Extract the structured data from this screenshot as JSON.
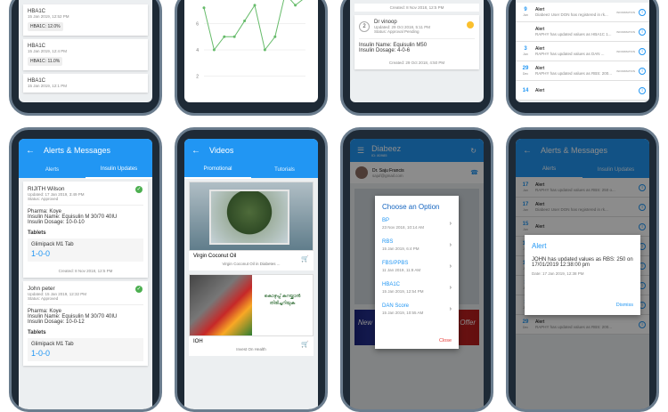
{
  "panel_top1": {
    "cards": [
      {
        "title": "HBA1C",
        "date": "15 Jan 2019, 12:52 PM",
        "value": "HBA1C: 12.0%"
      },
      {
        "title": "HBA1C",
        "date": "15 Jan 2019, 12:4 PM",
        "value": "HBA1C: 11.0%"
      },
      {
        "title": "HBA1C",
        "date": "15 Jan 2019, 12:1 PM"
      }
    ]
  },
  "panel_top2": {
    "chart_data": {
      "type": "line",
      "y_ticks": [
        "8",
        "6",
        "4",
        "2"
      ],
      "ylim": [
        0,
        8
      ],
      "grid": true,
      "values": [
        7.2,
        4,
        5,
        5,
        6.2,
        7.4,
        4,
        5,
        8.4,
        7.4,
        8
      ],
      "color": "#66bb6a"
    }
  },
  "panel_top3": {
    "created_top": "Created: 8 Nov 2018, 12:5 PM",
    "doctor_num": "2",
    "doctor_name": "Dr vinoop",
    "updated": "Updated: 29 Oct 2018, 5:11 PM",
    "status": "Status: Approval Pending",
    "insulin_name": "Insulin Name: Equisulin M50",
    "insulin_dosage": "Insulin Dosage: 4-0-6",
    "created": "Created: 29 Oct 2018, 4:50 PM"
  },
  "panel_top4": {
    "rows": [
      {
        "day": "9",
        "mon": "Jan",
        "title": "Alert",
        "text": "Diabeez User DON has registered in rk...",
        "tag": "INFORMATION"
      },
      {
        "day": "",
        "mon": "",
        "title": "Alert",
        "text": "RAPHY has updated values as HBA1C 1...",
        "tag": "INFORMATION"
      },
      {
        "day": "3",
        "mon": "Jan",
        "title": "Alert",
        "text": "RAPHY has updated values as DAN ...",
        "tag": "INFORMATION"
      },
      {
        "day": "29",
        "mon": "Dec",
        "title": "Alert",
        "text": "RAPHY has updated values as RBS: 200...",
        "tag": "INFORMATION"
      },
      {
        "day": "14",
        "mon": "",
        "title": "Alert",
        "text": "",
        "tag": ""
      }
    ]
  },
  "panel_alerts": {
    "title": "Alerts & Messages",
    "tabs": [
      "Alerts",
      "Insulin Updates"
    ],
    "card1": {
      "name": "RIJITH Wilson",
      "updated": "Updated: 17 Jan 2019, 3:49 PM",
      "status": "Status: Approved",
      "pharma": "Pharma: Koye",
      "insulin_name": "Insulin Name: Equisulin M 30/70 40IU",
      "insulin_dosage": "Insulin Dosage: 10-0-10",
      "tablets_label": "Tablets",
      "tablet_name": "Glimipack M1 Tab",
      "tablet_dose": "1-0-0",
      "created": "Created: 8 Nov 2018, 12:5 PM"
    },
    "card2": {
      "name": "John peter",
      "updated": "Updated: 15 Jan 2019, 12:32 PM",
      "status": "Status: Approved",
      "pharma": "Pharma: Koye",
      "insulin_name": "Insulin Name: Equisulin M 30/70 40IU",
      "insulin_dosage": "Insulin Dosage: 10-0-12",
      "tablets_label": "Tablets",
      "tablet_name": "Glimipack M1 Tab",
      "tablet_dose": "1-0-0"
    }
  },
  "panel_videos": {
    "title": "Videos",
    "tabs": [
      "Promotional",
      "Tutorials"
    ],
    "items": [
      {
        "title": "Virgin Coconut Oil",
        "subtitle": "Virgin Coconut Oil in Diabetes ..."
      },
      {
        "title": "IOH",
        "subtitle": "Invest On Health"
      }
    ],
    "ad_text": "കൊഴുപ്പ് കുറയ്ക്കാൻ തിരിച്ചറിയുക"
  },
  "panel_options": {
    "app_title": "Diabeez",
    "app_subtitle": "ID: 80985",
    "doctor": "Dr. Saju Francis",
    "email": "sajuf@gmail.com",
    "dialog_title": "Choose an Option",
    "options": [
      {
        "label": "BP",
        "date": "23 Nov 2018, 10:14 AM"
      },
      {
        "label": "RBS",
        "date": "15 Jan 2019, 6:4 PM"
      },
      {
        "label": "FBS/PPBS",
        "date": "11 Jan 2019, 11:8 AM"
      },
      {
        "label": "HBA1C",
        "date": "15 Jan 2019, 12:54 PM"
      },
      {
        "label": "DAN Score",
        "date": "15 Jan 2019, 10:55 AM"
      }
    ],
    "close": "Close",
    "banner1": "New Year",
    "banner2": "eem Offer"
  },
  "panel_alert_dialog": {
    "title": "Alerts & Messages",
    "tabs": [
      "Alerts",
      "Insulin Updates"
    ],
    "dialog_title": "Alert",
    "message": "JOHN has updated values as RBS: 250 on 17/01/2019 12:38:00 pm",
    "date": "Date: 17 Jan 2019, 12:38 PM",
    "dismiss": "Dismiss",
    "rows": [
      {
        "day": "17",
        "mon": "Jan",
        "title": "Alert",
        "text": "RAPHY has updated values as RBS: 250 o..."
      },
      {
        "day": "17",
        "mon": "Jan",
        "title": "Alert",
        "text": "Diabeez User DON has registered in rk..."
      },
      {
        "day": "15",
        "mon": "Jan",
        "title": "Alert",
        "text": ""
      },
      {
        "day": "15",
        "mon": "Jan",
        "title": "Alert",
        "text": ""
      },
      {
        "day": "11",
        "mon": "Jan",
        "title": "Alert",
        "text": ""
      },
      {
        "day": "3",
        "mon": "Jan",
        "title": "Alert",
        "text": ""
      },
      {
        "day": "3",
        "mon": "Jan",
        "title": "Alert",
        "text": "RAPHY has updated values as DAN..."
      },
      {
        "day": "29",
        "mon": "Dec",
        "title": "Alert",
        "text": "RAPHY has updated values as RBS: 200..."
      }
    ]
  }
}
